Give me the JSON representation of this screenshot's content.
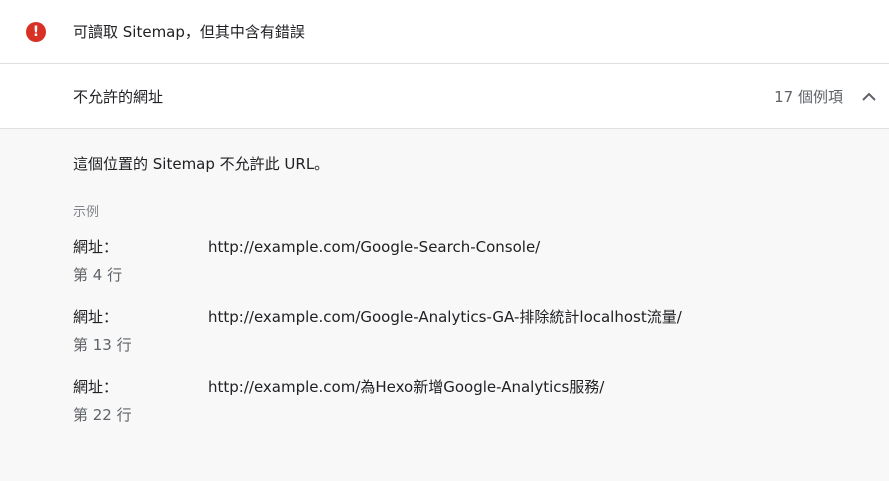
{
  "status": {
    "icon": "error-icon",
    "icon_glyph": "!",
    "icon_color": "#d93025",
    "text": "可讀取 Sitemap，但其中含有錯誤"
  },
  "section": {
    "title": "不允許的網址",
    "count": "17 個例項",
    "chevron_icon": "chevron-up-icon"
  },
  "detail": {
    "description": "這個位置的 Sitemap 不允許此 URL。",
    "examples_label": "示例",
    "examples": [
      {
        "key": "網址：",
        "line": "第 4 行",
        "url": "http://example.com/Google-Search-Console/"
      },
      {
        "key": "網址：",
        "line": "第 13 行",
        "url": "http://example.com/Google-Analytics-GA-排除統計localhost流量/"
      },
      {
        "key": "網址：",
        "line": "第 22 行",
        "url": "http://example.com/為Hexo新增Google-Analytics服務/"
      }
    ]
  }
}
